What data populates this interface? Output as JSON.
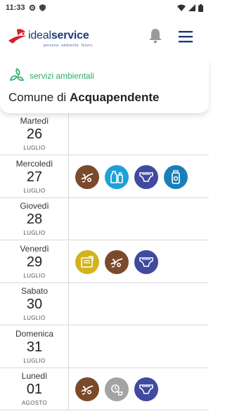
{
  "status_bar": {
    "time": "11:33"
  },
  "header": {
    "brand_prefix": "ideal",
    "brand_suffix": "service",
    "tagline": "persone. ambiente. futuro.",
    "service_label": "servizi ambientali",
    "comune_prefix": "Comune di ",
    "comune_name": "Acquapendente"
  },
  "colors": {
    "organico": "#7a4a2b",
    "vetro": "#1ea0d8",
    "pannolini": "#3f4aa0",
    "plastica": "#1a7fb8",
    "carta": "#d2b31c",
    "secco": "#a3a3a3",
    "accent_green": "#2aaa63",
    "brand_blue": "#1b3a7a"
  },
  "days": [
    {
      "name": "Martedì",
      "num": "26",
      "month": "LUGLIO",
      "icons": []
    },
    {
      "name": "Mercoledì",
      "num": "27",
      "month": "LUGLIO",
      "icons": [
        "organico",
        "vetro",
        "pannolini",
        "plastica"
      ]
    },
    {
      "name": "Giovedì",
      "num": "28",
      "month": "LUGLIO",
      "icons": []
    },
    {
      "name": "Venerdì",
      "num": "29",
      "month": "LUGLIO",
      "icons": [
        "carta",
        "organico",
        "pannolini"
      ]
    },
    {
      "name": "Sabato",
      "num": "30",
      "month": "LUGLIO",
      "icons": []
    },
    {
      "name": "Domenica",
      "num": "31",
      "month": "LUGLIO",
      "icons": []
    },
    {
      "name": "Lunedì",
      "num": "01",
      "month": "AGOSTO",
      "icons": [
        "organico",
        "secco",
        "pannolini"
      ]
    }
  ]
}
